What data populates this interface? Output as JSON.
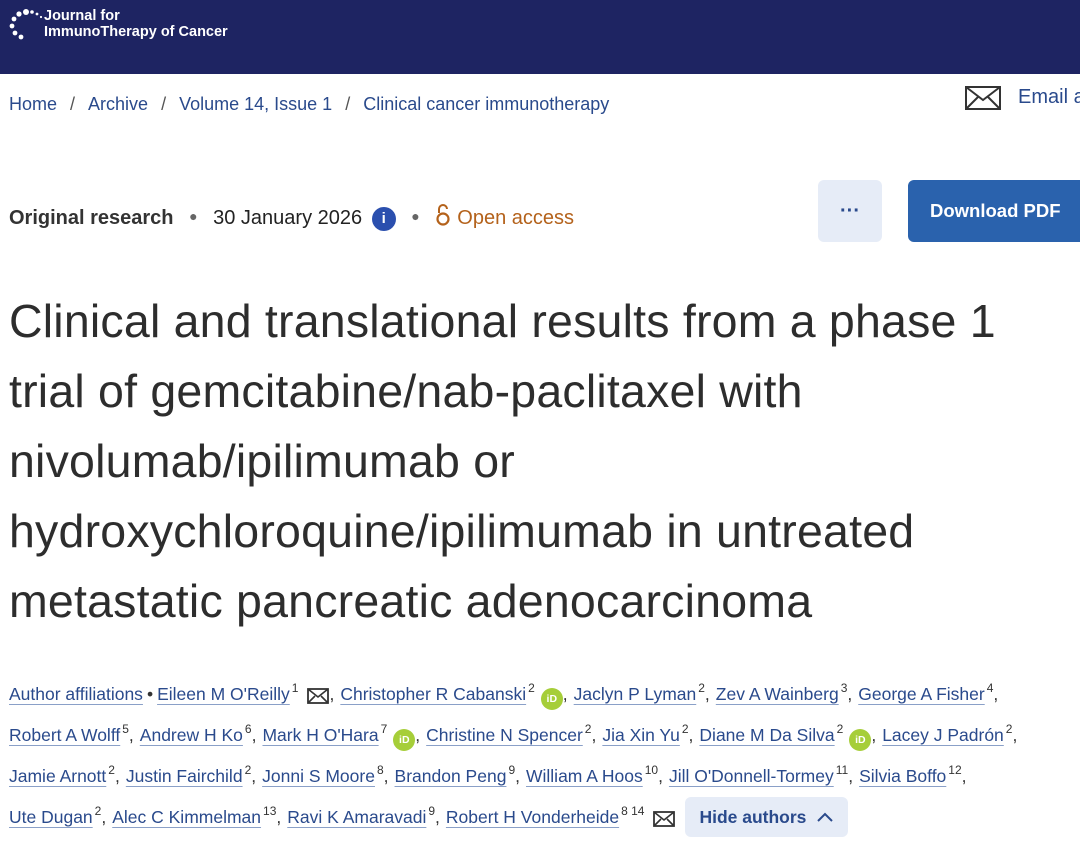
{
  "header": {
    "logo_line1": "Journal for",
    "logo_line2": "ImmunoTherapy of Cancer"
  },
  "breadcrumb": [
    "Home",
    "Archive",
    "Volume 14, Issue 1",
    "Clinical cancer immunotherapy"
  ],
  "email_label": "Email a",
  "meta": {
    "type": "Original research",
    "date": "30 January 2026",
    "access": "Open access"
  },
  "actions": {
    "more": "···",
    "download": "Download PDF"
  },
  "title_lines": [
    "Clinical and translational results from a phase 1",
    "trial of gemcitabine/nab-paclitaxel with",
    "nivolumab/ipilimumab or",
    "hydroxychloroquine/ipilimumab in untreated",
    "metastatic pancreatic adenocarcinoma"
  ],
  "affiliations_label": "Author affiliations",
  "authors": {
    "line1": [
      {
        "name": "Eileen M O'Reilly",
        "sup": "1",
        "email": true
      },
      {
        "name": "Christopher R Cabanski",
        "sup": "2",
        "orcid": true
      },
      {
        "name": "Jaclyn P Lyman",
        "sup": "2"
      },
      {
        "name": "Zev A Wainberg",
        "sup": "3"
      },
      {
        "name": "George A Fisher",
        "sup": "4"
      }
    ],
    "line2": [
      {
        "name": "Robert A Wolff",
        "sup": "5"
      },
      {
        "name": "Andrew H Ko",
        "sup": "6"
      },
      {
        "name": "Mark H O'Hara",
        "sup": "7",
        "orcid": true
      },
      {
        "name": "Christine N Spencer",
        "sup": "2"
      },
      {
        "name": "Jia Xin Yu",
        "sup": "2"
      },
      {
        "name": "Diane M Da Silva",
        "sup": "2",
        "orcid": true
      },
      {
        "name": "Lacey J Padrón",
        "sup": "2"
      }
    ],
    "line3": [
      {
        "name": "Jamie Arnott",
        "sup": "2"
      },
      {
        "name": "Justin Fairchild",
        "sup": "2"
      },
      {
        "name": "Jonni S Moore",
        "sup": "8"
      },
      {
        "name": "Brandon Peng",
        "sup": "9"
      },
      {
        "name": "William A Hoos",
        "sup": "10"
      },
      {
        "name": "Jill O'Donnell-Tormey",
        "sup": "11"
      },
      {
        "name": "Silvia Boffo",
        "sup": "12"
      }
    ],
    "line4": [
      {
        "name": "Ute Dugan",
        "sup": "2"
      },
      {
        "name": "Alec C Kimmelman",
        "sup": "13"
      },
      {
        "name": "Ravi K Amaravadi",
        "sup": "9"
      },
      {
        "name": "Robert H Vonderheide",
        "sup": "8 14",
        "email": true
      }
    ]
  },
  "orcid_label": "iD",
  "hide_authors": "Hide authors"
}
